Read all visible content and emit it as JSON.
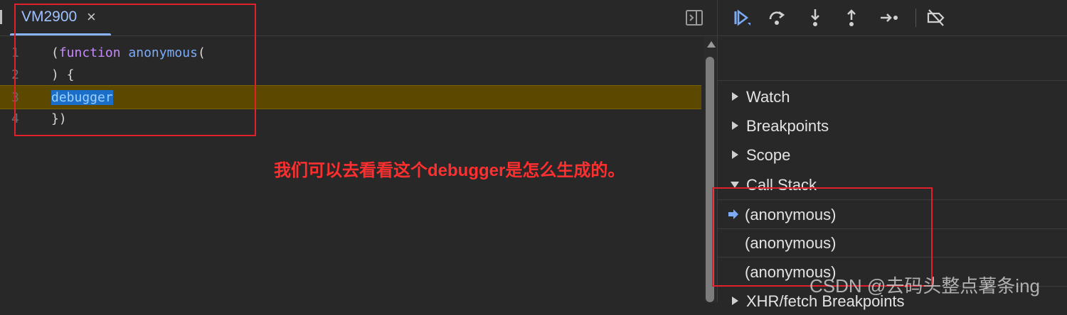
{
  "editor": {
    "tab_title": "VM2900",
    "tab_close": "×",
    "lines": [
      {
        "num": "1",
        "parts": [
          {
            "t": "(",
            "c": ""
          },
          {
            "t": "function",
            "c": "kw"
          },
          {
            "t": " ",
            "c": ""
          },
          {
            "t": "anonymous",
            "c": "fn"
          },
          {
            "t": "(",
            "c": ""
          }
        ]
      },
      {
        "num": "2",
        "parts": [
          {
            "t": ") {",
            "c": ""
          }
        ]
      },
      {
        "num": "3",
        "parts": [
          {
            "t": "debugger",
            "c": "sel"
          }
        ]
      },
      {
        "num": "4",
        "parts": [
          {
            "t": "})",
            "c": ""
          }
        ]
      }
    ],
    "paused_line": 3
  },
  "annotation": {
    "text": "我们可以去看看这个debugger是怎么生成的。",
    "color": "#ff2f2f"
  },
  "debugger_toolbar": {
    "buttons": [
      "resume-icon",
      "step-over-icon",
      "step-into-icon",
      "step-out-icon",
      "step-icon",
      "deactivate-breakpoints-icon"
    ]
  },
  "sidebar": {
    "sections": [
      {
        "label": "Watch",
        "expanded": false
      },
      {
        "label": "Breakpoints",
        "expanded": false
      },
      {
        "label": "Scope",
        "expanded": false
      },
      {
        "label": "Call Stack",
        "expanded": true
      }
    ],
    "call_stack": [
      "(anonymous)",
      "(anonymous)",
      "(anonymous)"
    ],
    "next_section": "XHR/fetch Breakpoints"
  },
  "watermark": "CSDN @去码头整点薯条ing",
  "colors": {
    "background": "#282828",
    "accent": "#8ab4f8",
    "paused_line": "#5d4800",
    "annotation_red": "#e0202a"
  }
}
